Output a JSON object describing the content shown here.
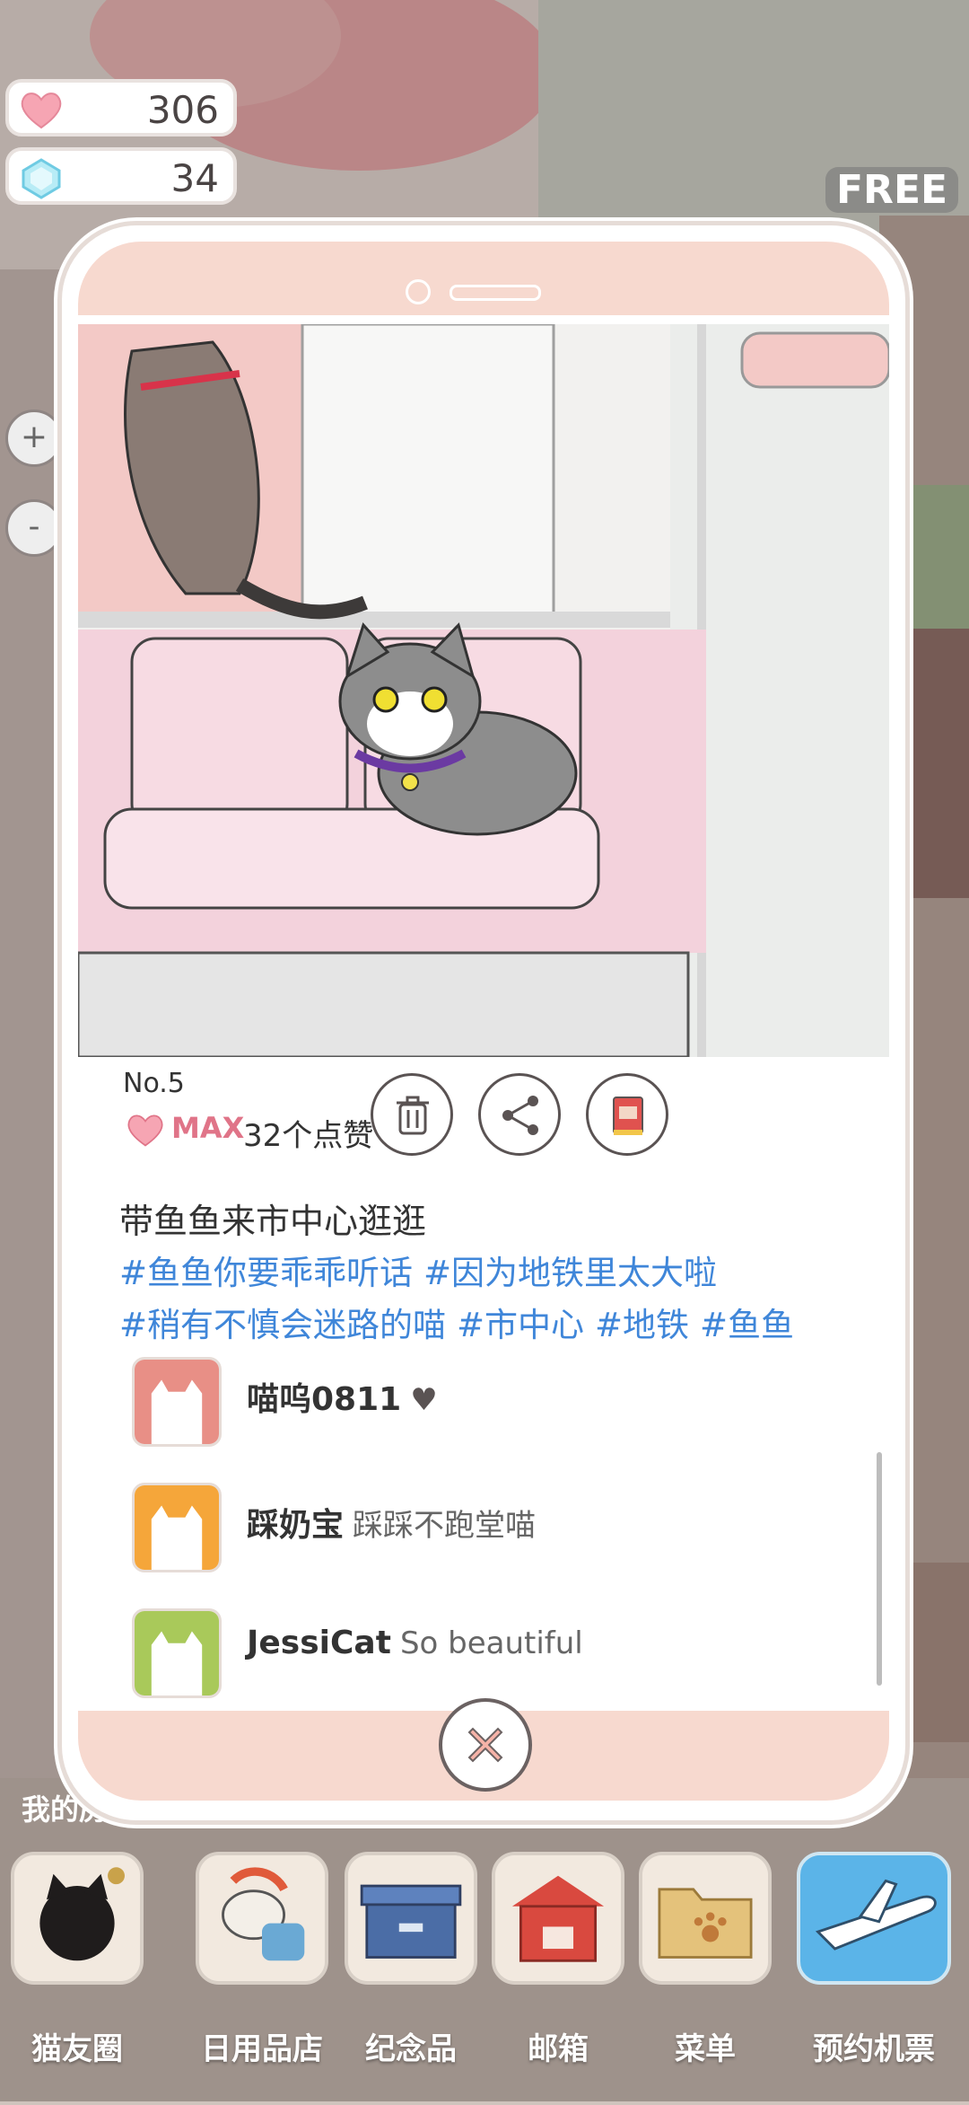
{
  "currency": {
    "hearts": {
      "icon": "heart-icon",
      "value": "306"
    },
    "gems": {
      "icon": "diamond-icon",
      "value": "34"
    },
    "free_label": "FREE"
  },
  "post": {
    "number": "No.5",
    "like_level": "MAX",
    "like_count": "32个点赞",
    "caption": "带鱼鱼来市中心逛逛",
    "tags_line1": [
      "#鱼鱼你要乖乖听话",
      "#因为地铁里太大啦"
    ],
    "tags_line2": [
      "#稍有不慎会迷路的喵",
      "#市中心",
      "#地铁",
      "#鱼鱼"
    ],
    "actions": {
      "delete": "trash-icon",
      "share": "share-icon",
      "album": "album-icon"
    }
  },
  "comments": [
    {
      "user": "喵呜0811",
      "text": "",
      "heart": "♥",
      "avatar_color": "#e88f86"
    },
    {
      "user": "踩奶宝",
      "text": "踩踩不跑堂喵",
      "heart": "",
      "avatar_color": "#f5a63a"
    },
    {
      "user": "JessiCat",
      "text": "So beautiful",
      "heart": "",
      "avatar_color": "#a9c95a"
    }
  ],
  "side_label": "我的房",
  "nav": [
    {
      "label": "猫友圈",
      "icon": "cat-camera-icon"
    },
    {
      "label": "日用品店",
      "icon": "shop-icon"
    },
    {
      "label": "纪念品",
      "icon": "box-icon"
    },
    {
      "label": "邮箱",
      "icon": "mailbox-icon"
    },
    {
      "label": "菜单",
      "icon": "folder-icon"
    },
    {
      "label": "预约机票",
      "icon": "airplane-icon"
    }
  ],
  "colors": {
    "tag": "#3f86d9",
    "max": "#e07488",
    "frame_pink": "#f7d9cf"
  }
}
